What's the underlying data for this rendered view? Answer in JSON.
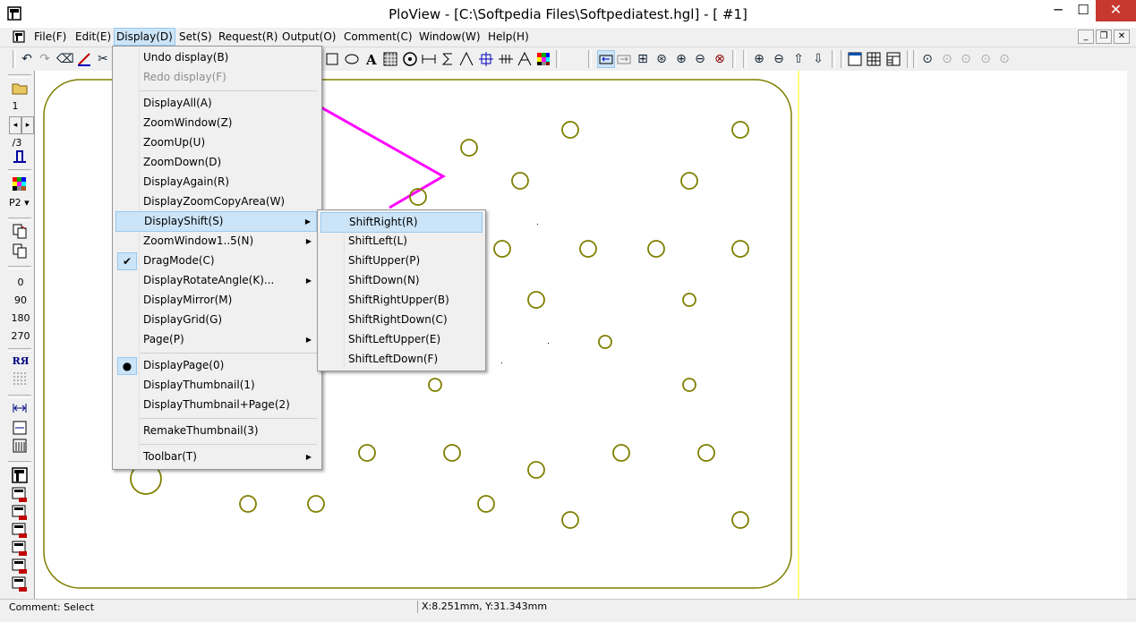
{
  "window": {
    "title": "PloView - [C:\\Softpedia Files\\Softpediatest.hgl] - [ #1]",
    "minimize": "─",
    "maximize": "☐",
    "close": "✕"
  },
  "menubar": {
    "items": [
      "File(F)",
      "Edit(E)",
      "Display(D)",
      "Set(S)",
      "Request(R)",
      "Output(O)",
      "Comment(C)",
      "Window(W)",
      "Help(H)"
    ],
    "active": "Display(D)",
    "mdi_min": "_",
    "mdi_restore": "❐",
    "mdi_close": "✕"
  },
  "left_toolbar": {
    "page_num": "1",
    "page_total": "/3",
    "pen_label": "P2",
    "rotate": [
      "0",
      "90",
      "180",
      "270"
    ],
    "mirror_label": "RЯ"
  },
  "display_menu": {
    "items": [
      {
        "label": "Undo display(B)"
      },
      {
        "label": "Redo display(F)",
        "disabled": true
      },
      {
        "label": "DisplayAll(A)"
      },
      {
        "label": "ZoomWindow(Z)"
      },
      {
        "label": "ZoomUp(U)"
      },
      {
        "label": "ZoomDown(D)"
      },
      {
        "label": "DisplayAgain(R)"
      },
      {
        "label": "DisplayZoomCopyArea(W)"
      },
      {
        "label": "DisplayShift(S)",
        "submenu": true,
        "highlighted": true
      },
      {
        "label": "ZoomWindow1..5(N)",
        "submenu": true
      },
      {
        "label": "DragMode(C)",
        "checked": true
      },
      {
        "label": "DisplayRotateAngle(K)...",
        "submenu": true
      },
      {
        "label": "DisplayMirror(M)"
      },
      {
        "label": "DisplayGrid(G)"
      },
      {
        "label": "Page(P)",
        "submenu": true
      },
      {
        "label": "DisplayPage(0)",
        "radio": true
      },
      {
        "label": "DisplayThumbnail(1)"
      },
      {
        "label": "DisplayThumbnail+Page(2)"
      },
      {
        "label": "RemakeThumbnail(3)"
      },
      {
        "label": "Toolbar(T)",
        "submenu": true
      }
    ],
    "check_glyph": "✔",
    "radio_glyph": "●",
    "arrow_glyph": "▶"
  },
  "shift_menu": {
    "items": [
      "ShiftRight(R)",
      "ShiftLeft(L)",
      "ShiftUpper(P)",
      "ShiftDown(N)",
      "ShiftRightUpper(B)",
      "ShiftRightDown(C)",
      "ShiftLeftUpper(E)",
      "ShiftLeftDown(F)"
    ],
    "highlighted": "ShiftRight(R)"
  },
  "status": {
    "comment": "Comment: Select",
    "coords": "X:8.251mm, Y:31.343mm"
  },
  "colors": {
    "drawing_outline": "#7f7f00",
    "pen_line": "#ff00ff",
    "menu_highlight": "#cce4f7",
    "close_button": "#c7382f"
  },
  "icons": {
    "undo": "↶",
    "redo": "↷",
    "eraser": "⌫",
    "scissors": "✂",
    "text": "A",
    "zoom_in": "⊕",
    "zoom_out": "⊖",
    "folder": "📂"
  }
}
